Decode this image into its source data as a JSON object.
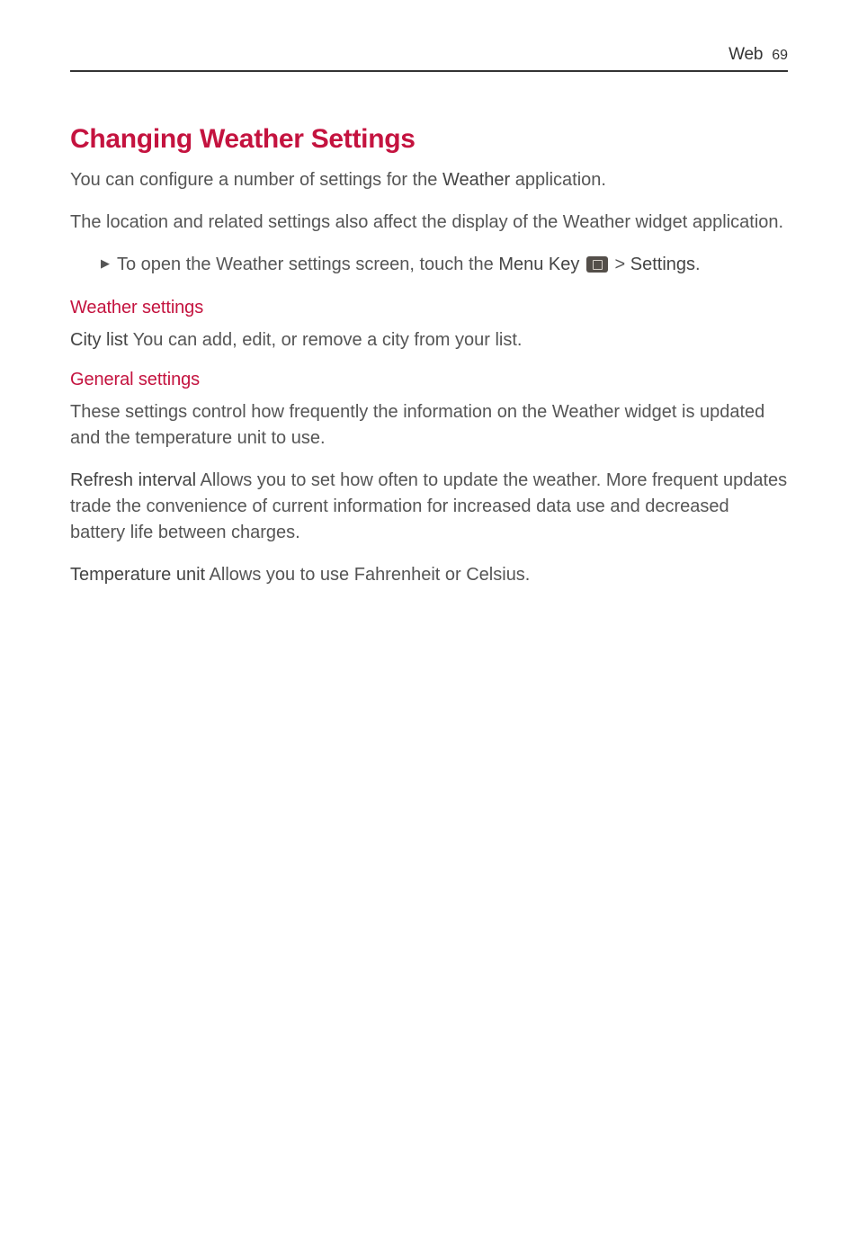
{
  "header": {
    "section": "Web",
    "page_number": "69"
  },
  "main_heading": "Changing Weather Settings",
  "intro_1_a": "You can configure a number of settings for the ",
  "intro_1_b": "Weather",
  "intro_1_c": " application.",
  "intro_2": "The location and related settings also affect the display of the Weather widget application.",
  "bullet": {
    "part_a": "To open the Weather settings screen, touch the ",
    "part_b": "Menu Key ",
    "part_c": " > ",
    "part_d": "Settings",
    "part_e": "."
  },
  "headings": {
    "weather_settings": "Weather settings",
    "general_settings": "General settings"
  },
  "city_list": {
    "label": "City list",
    "text": " You can add, edit, or remove a city from your list."
  },
  "general_intro": "These settings control how frequently the information on the Weather widget is updated and the temperature unit to use.",
  "refresh_interval": {
    "label": "Refresh interval",
    "text": " Allows you to set how often to update the weather. More frequent updates trade the convenience of current information for increased data use and decreased battery life between charges."
  },
  "temperature_unit": {
    "label": "Temperature unit",
    "text": " Allows you to use Fahrenheit or Celsius."
  }
}
